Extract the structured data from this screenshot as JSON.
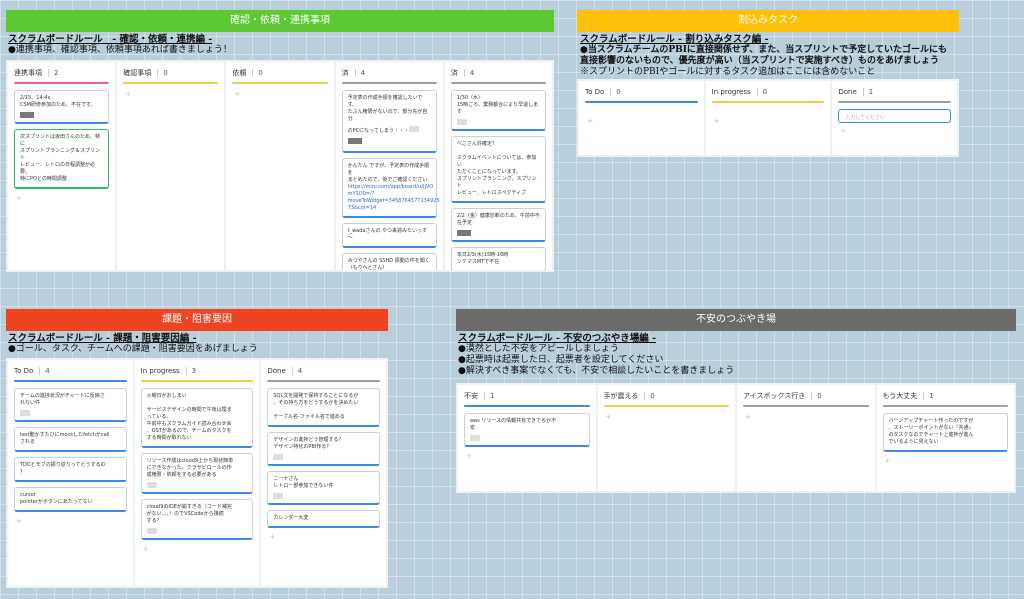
{
  "colors": {
    "green": "#5cc832",
    "yellow": "#ffc107",
    "red": "#ee4422",
    "gray": "#6b6b6b",
    "blue_line": "#3b8ae0"
  },
  "confirm": {
    "banner": "確認・依頼・連携事項",
    "rule": "スクラムボードルール　- 確認・依頼・連携編 -",
    "desc": "●連携事項、確認事項、依頼事項あれば書きましょう！",
    "columns": [
      {
        "title": "連携事項",
        "count": "2",
        "line": "#ea5fa0",
        "cards": [
          "2/15、14:4x\nCSM研修参加のため、不在です。",
          "次スプリントは坂田さんのため、特に\nスプリントプランニング＆スプリント\nレビュー、レトロの日程調整が必要。\n特にPOとの時間調整"
        ]
      },
      {
        "title": "確認事項",
        "count": "0",
        "line": "#f3c84b",
        "cards": []
      },
      {
        "title": "依頼",
        "count": "0",
        "line": "#f3c84b",
        "cards": []
      },
      {
        "title": "済",
        "count": "4",
        "line": "#9aa0a6",
        "cards": [
          "予定表の作成手順を確認したいです。\nたぶん権限がないので、部分先が自分\nのPCになってしまう・・・",
          "かんたん ですが、予定表の作成手順を\nまとめたので、後でご確認ください",
          "https://miro.com/app/board/uXjVO\nmY1D0=/?\nmoveToWidget=3458764577134925\n73&cot=14",
          "t_wadaさんの やつ来週みたいっす～",
          "みつやさんの SSHD 振動の件を聞く\n（もりへとさん）"
        ]
      },
      {
        "title": "済",
        "count": "4",
        "line": "#9aa0a6",
        "cards": [
          "1/30（水）\n15時ごろ、業務都合により早退します",
          "べこさん外確定？",
          "スクラムイベントについては、参加い\nただくことになっています。\nスプリントプランニング、スプリント\nレビュー、レトロスペクティブ",
          "2/2（金）健康診断のため、午前中不\n在予定",
          "本日2/3(水)15時-16時\nソケマスMTで不在"
        ]
      }
    ]
  },
  "interrupt": {
    "banner": "割込みタスク",
    "rule": "スクラムボードルール - 割り込みタスク編 -",
    "desc1": "●当スクラムチームのPBIに直接関係せず、また、当スプリントで予定していたゴールにも",
    "desc2": "直接影響のないもので、優先度が高い（当スプリントで実施すべき）ものをあげましょう",
    "desc3": "※スプリントのPBIやゴールに対するタスク追加はここには含めないこと",
    "columns": [
      {
        "title": "To Do",
        "count": "0",
        "line": "#3b8ae0"
      },
      {
        "title": "In progress",
        "count": "0",
        "line": "#f3c84b"
      },
      {
        "title": "Done",
        "count": "1",
        "line": "#9aa0a6"
      }
    ],
    "input_placeholder": "入力してください"
  },
  "blocker": {
    "banner": "課題・阻害要因",
    "rule": "スクラムボードルール - 課題・阻害要因編 -",
    "desc": "●ゴール、タスク、チームへの課題・阻害要因をあげましょう",
    "columns": [
      {
        "title": "To Do",
        "count": "4",
        "line": "#3b8ae0",
        "cards": [
          "チームの進捗状況がチャートに反映さ\nれない件",
          "test動かすたびにmockしたfetchがcall\nされる",
          "TDDとモブの振り返りってどうするの\n？",
          "cursor\npointerがボタンにあたってない"
        ]
      },
      {
        "title": "In progress",
        "count": "3",
        "line": "#f3c84b",
        "cards": [
          "火曜日がおしまい\n\nサービスデザインの時間で午後は埋ま\nっている。\n午前中もスクラムガイド読み合わせ会\n、OSTがあるので、チームのタスクを\nする時間が取れない",
          "リソース作成はcloud9上から現状簡単\nにできなかった。クラサビロールの作\n成権限・依頼をする必要がある",
          "cloud9のIDEが崩すぎる（コード補完\nがない、、、）のでVSCodeから接続\nする？"
        ]
      },
      {
        "title": "Done",
        "count": "4",
        "line": "#9aa0a6",
        "cards": [
          "SQL文を開発で保持することになるが\n、その持ち方をどうするかを決めたい\n\nテーブル名-ファイル名で進める",
          "デザインの進捗どう管理する？\nデザイン特化のPBI作る？",
          "ニーナさん\nレトロー部参加できない件",
          "カレンダー大変"
        ]
      }
    ]
  },
  "anxiety": {
    "banner": "不安のつぶやき場",
    "rule": "スクラムボードルール - 不安のつぶやき場編 -",
    "desc1": "●漠然とした不安をアピールしましょう",
    "desc2": "●起票時は起票した日、起票者を設定してください",
    "desc3": "●解決すべき事案でなくても、不安で相談したいことを書きましょう",
    "columns": [
      {
        "title": "不安",
        "count": "1",
        "line": "#3b8ae0",
        "cards": [
          "aws リソースの情報共有できてるか不\n安"
        ]
      },
      {
        "title": "手が震える",
        "count": "0",
        "line": "#f3c84b",
        "cards": []
      },
      {
        "title": "アイスボックス行き",
        "count": "0",
        "line": "#9aa0a6",
        "cards": []
      },
      {
        "title": "もう大丈夫",
        "count": "1",
        "line": "#9aa0a6",
        "cards": [
          "バーンアップチャート作ったのですが\n、ストーリーポイントがない『共通』\nのタスクなのでチャート上進捗が進ん\nでいるように見えない"
        ]
      }
    ]
  }
}
